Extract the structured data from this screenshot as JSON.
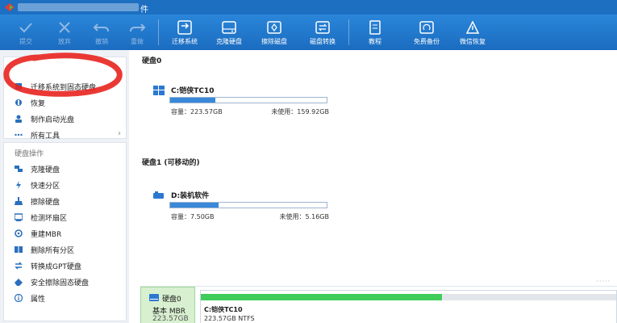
{
  "titlebar": {
    "title": "件"
  },
  "toolbar": {
    "left": [
      {
        "label": "提交",
        "icon": "check-icon"
      },
      {
        "label": "放弃",
        "icon": "cancel-icon"
      },
      {
        "label": "撤销",
        "icon": "undo-icon"
      },
      {
        "label": "重做",
        "icon": "redo-icon"
      }
    ],
    "right": [
      {
        "label": "迁移系统",
        "icon": "migrate-os-icon"
      },
      {
        "label": "克隆硬盘",
        "icon": "clone-disk-icon"
      },
      {
        "label": "擦除磁盘",
        "icon": "wipe-disk-icon"
      },
      {
        "label": "磁盘转换",
        "icon": "disk-convert-icon"
      },
      {
        "label": "教程",
        "icon": "tutorial-icon"
      },
      {
        "label": "免费备份",
        "icon": "free-backup-icon"
      },
      {
        "label": "微信恢复",
        "icon": "wechat-recovery-icon"
      }
    ]
  },
  "sidebar": {
    "top_items": [
      {
        "label": "迁移系统到固态硬盘",
        "icon": "migrate-icon"
      },
      {
        "label": "恢复",
        "icon": "recover-icon"
      },
      {
        "label": "制作启动光盘",
        "icon": "bootable-media-icon"
      },
      {
        "label": "所有工具",
        "icon": "more-icon",
        "chevron": "›"
      }
    ],
    "section_heading": "硬盘操作",
    "disk_items": [
      {
        "label": "克隆硬盘",
        "icon": "clone-icon"
      },
      {
        "label": "快速分区",
        "icon": "quick-partition-icon"
      },
      {
        "label": "擦除硬盘",
        "icon": "wipe-icon"
      },
      {
        "label": "检测坏扇区",
        "icon": "bad-sector-icon"
      },
      {
        "label": "重建MBR",
        "icon": "rebuild-mbr-icon"
      },
      {
        "label": "删除所有分区",
        "icon": "delete-partitions-icon"
      },
      {
        "label": "转换成GPT硬盘",
        "icon": "convert-gpt-icon"
      },
      {
        "label": "安全擦除固态硬盘",
        "icon": "secure-erase-icon"
      },
      {
        "label": "属性",
        "icon": "info-icon"
      }
    ]
  },
  "main": {
    "disks": [
      {
        "title": "硬盘0",
        "partition": {
          "name": "C:铠侠TC10",
          "capacity_label": "容量：223.57GB",
          "free_label": "未使用：159.92GB",
          "used_fraction": 0.29,
          "icon": "windows-icon"
        }
      },
      {
        "title": "硬盘1 (可移动的)",
        "partition": {
          "name": "D:装机软件",
          "capacity_label": "容量：7.50GB",
          "free_label": "未使用：5.16GB",
          "used_fraction": 0.31,
          "icon": "usb-drive-icon"
        }
      }
    ]
  },
  "bottom": {
    "disk_name": "硬盘0",
    "disk_type": "基本 MBR",
    "disk_size": "223.57GB",
    "partition_name": "C:铠侠TC10",
    "partition_info": "223.57GB NTFS",
    "used_fraction": 0.58
  },
  "colors": {
    "titlebar": "#1d6fc2",
    "toolbar": "#2a86d9",
    "bar_fill": "#3a88d8",
    "map_fill": "#3fcc5a",
    "scribble": "#e8231f"
  }
}
